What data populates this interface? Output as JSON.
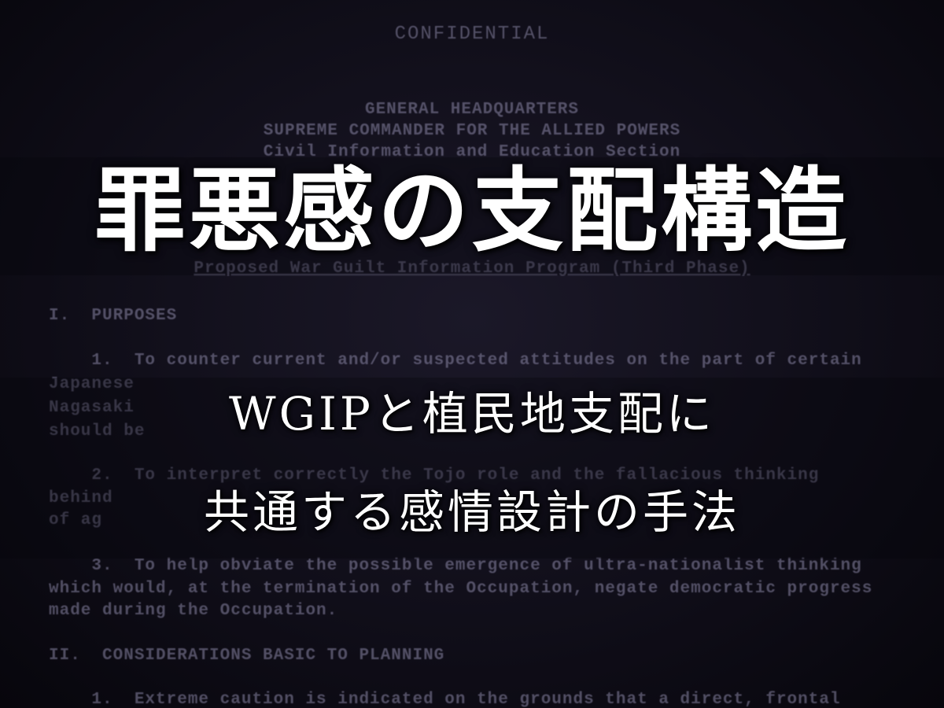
{
  "background_document": {
    "confidential": "CONFIDENTIAL",
    "header_lines": [
      "GENERAL HEADQUARTERS",
      "SUPREME COMMANDER FOR THE ALLIED POWERS",
      "Civil Information and Education Section"
    ],
    "program_title": "Proposed War Guilt Information Program (Third Phase)",
    "body_lines": [
      "I.  PURPOSES",
      "    1.  To counter current and/or suspected attitudes on the part of certain",
      "Japanese",
      "Nagasaki",
      "should be",
      "    2.  To interpret correctly the Tojo role and the fallacious thinking",
      "behind",
      "of ag",
      "    3.  To help obviate the possible emergence of ultra-nationalist thinking",
      "which would, at the termination of the Occupation, negate democratic progress",
      "made during the Occupation.",
      "II.  CONSIDERATIONS BASIC TO PLANNING",
      "    1.  Extreme caution is indicated on the grounds that a direct, frontal"
    ]
  },
  "overlay": {
    "title": "罪悪感の支配構造",
    "subtitle_line1": "WGIPと植民地支配に",
    "subtitle_line2": "共通する感情設計の手法"
  }
}
